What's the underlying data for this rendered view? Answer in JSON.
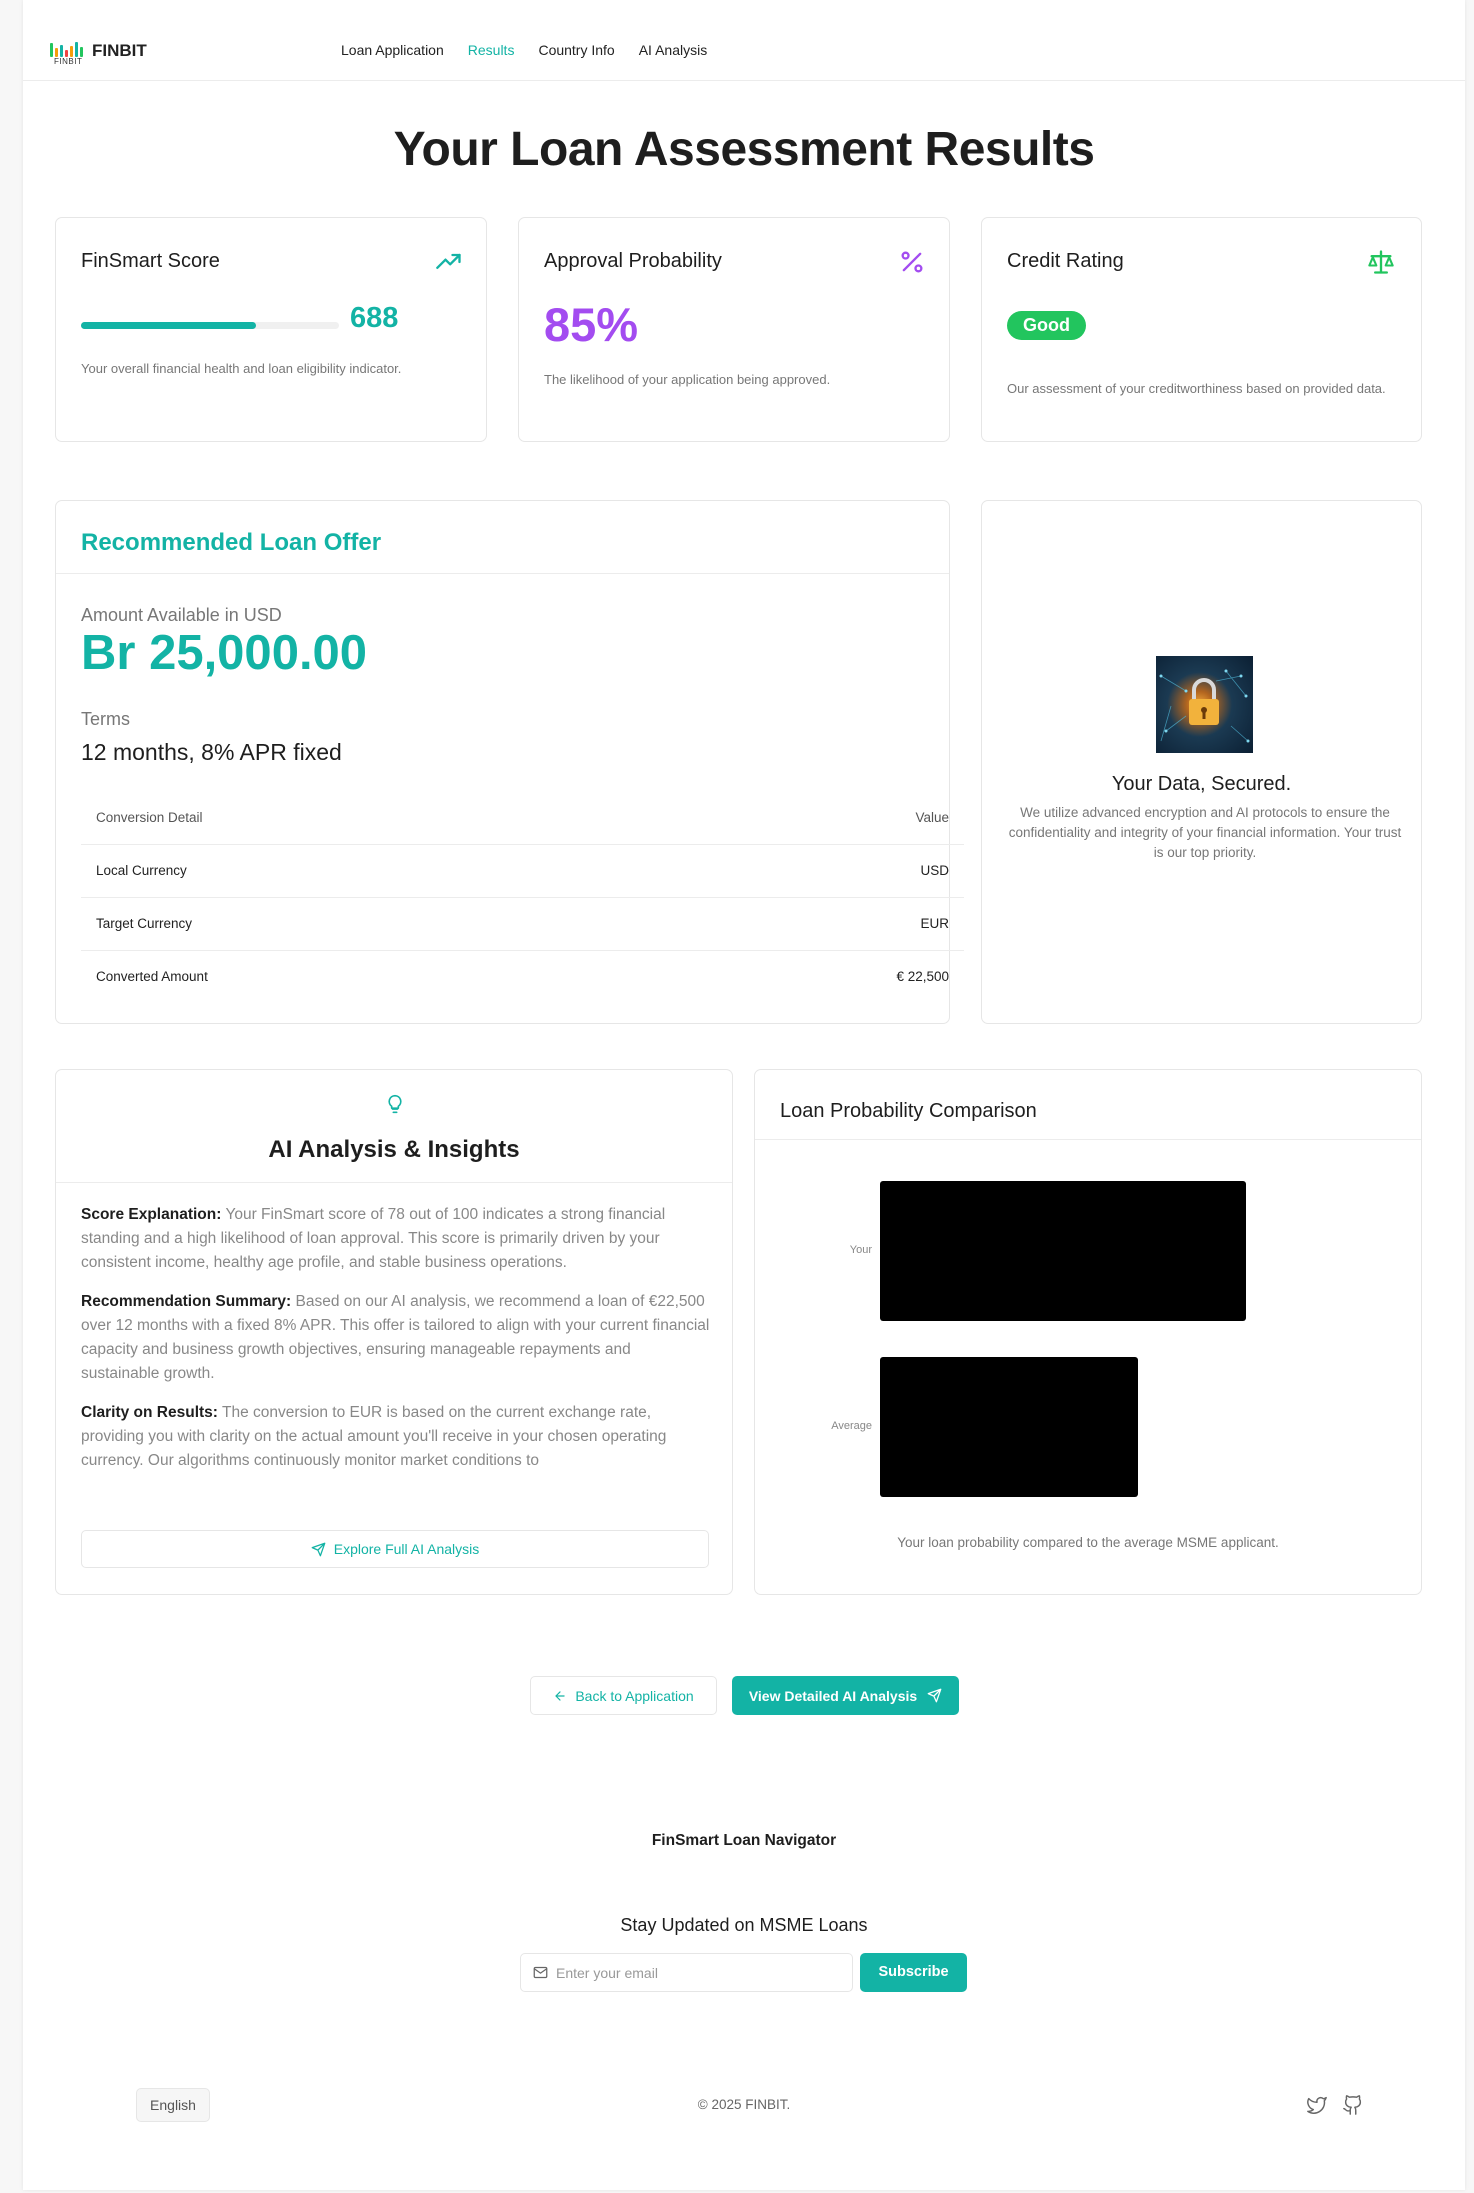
{
  "nav": {
    "logo_text": "FINBIT",
    "logo_sub": "FINBIT",
    "links": [
      {
        "label": "Loan Application",
        "active": false
      },
      {
        "label": "Results",
        "active": true
      },
      {
        "label": "Country Info",
        "active": false
      },
      {
        "label": "AI Analysis",
        "active": false
      }
    ]
  },
  "page_title": "Your Loan Assessment Results",
  "cards": {
    "score": {
      "title": "FinSmart Score",
      "value": "688",
      "progress": 0.68,
      "desc": "Your overall financial health and loan eligibility indicator.",
      "icon": "trending-up-icon"
    },
    "approval": {
      "title": "Approval Probability",
      "value": "85%",
      "desc": "The likelihood of your application being approved.",
      "icon": "percent-icon"
    },
    "credit": {
      "title": "Credit Rating",
      "badge": "Good",
      "desc": "Our assessment of your creditworthiness based on provided data.",
      "icon": "scale-icon"
    }
  },
  "offer": {
    "title": "Recommended Loan Offer",
    "amount_label": "Amount Available in USD",
    "amount": "Br 25,000.00",
    "terms_label": "Terms",
    "terms": "12 months, 8% APR fixed",
    "table": {
      "headers": [
        "Conversion Detail",
        "Value"
      ],
      "rows": [
        [
          "Local Currency",
          "USD"
        ],
        [
          "Target Currency",
          "EUR"
        ],
        [
          "Converted Amount",
          "€ 22,500"
        ]
      ]
    }
  },
  "security": {
    "title": "Your Data, Secured.",
    "desc": "We utilize advanced encryption and AI protocols to ensure the confidentiality and integrity of your financial information. Your trust is our top priority."
  },
  "ai": {
    "title": "AI Analysis & Insights",
    "sections": [
      {
        "label": "Score Explanation:",
        "text": "Your FinSmart score of 78 out of 100 indicates a strong financial standing and a high likelihood of loan approval. This score is primarily driven by your consistent income, healthy age profile, and stable business operations."
      },
      {
        "label": "Recommendation Summary:",
        "text": "Based on our AI analysis, we recommend a loan of €22,500 over 12 months with a fixed 8% APR. This offer is tailored to align with your current financial capacity and business growth objectives, ensuring manageable repayments and sustainable growth."
      },
      {
        "label": "Clarity on Results:",
        "text": "The conversion to EUR is based on the current exchange rate, providing you with clarity on the actual amount you'll receive in your chosen operating currency. Our algorithms continuously monitor market conditions to"
      }
    ],
    "explore_button": "Explore Full AI Analysis"
  },
  "comparison": {
    "title": "Loan Probability Comparison",
    "caption": "Your loan probability compared to the average MSME applicant."
  },
  "chart_data": {
    "type": "bar",
    "orientation": "horizontal",
    "categories": [
      "Your",
      "Average"
    ],
    "values": [
      85,
      60
    ],
    "colors": [
      "#000000",
      "#000000"
    ]
  },
  "actions": {
    "back": "Back to Application",
    "detail": "View Detailed AI Analysis"
  },
  "footer": {
    "brand": "FinSmart Loan Navigator",
    "newsletter_title": "Stay Updated on MSME Loans",
    "email_placeholder": "Enter your email",
    "subscribe": "Subscribe",
    "language": "English",
    "copyright": "© 2025 FINBIT."
  },
  "colors": {
    "accent": "#13b3a5",
    "purple": "#a34cf0",
    "good": "#22c55e"
  }
}
